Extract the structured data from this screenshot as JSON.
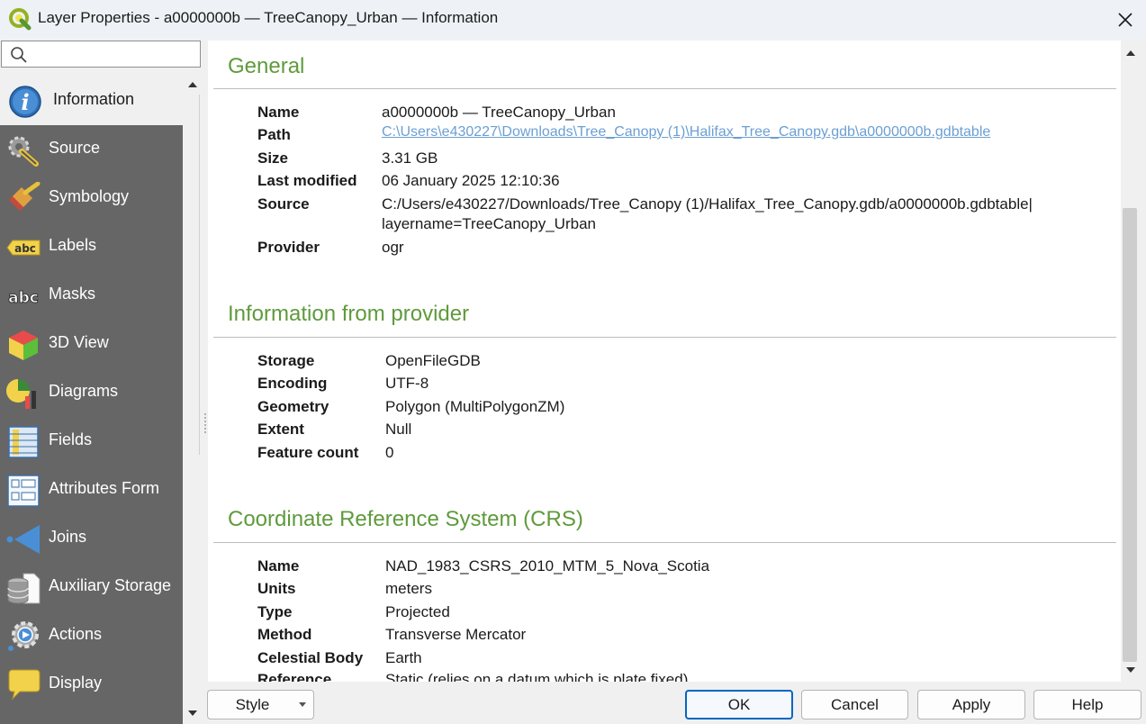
{
  "window": {
    "title": "Layer Properties - a0000000b — TreeCanopy_Urban — Information"
  },
  "search": {
    "placeholder": "",
    "value": ""
  },
  "sidebar": {
    "items": [
      {
        "label": "Information",
        "icon": "info-icon",
        "active": true
      },
      {
        "label": "Source",
        "icon": "source-wrench-icon"
      },
      {
        "label": "Symbology",
        "icon": "paintbrush-icon"
      },
      {
        "label": "Labels",
        "icon": "labels-abc-icon"
      },
      {
        "label": "Masks",
        "icon": "masks-abc-icon"
      },
      {
        "label": "3D View",
        "icon": "cube-icon"
      },
      {
        "label": "Diagrams",
        "icon": "diagram-icon"
      },
      {
        "label": "Fields",
        "icon": "fields-icon"
      },
      {
        "label": "Attributes Form",
        "icon": "form-icon"
      },
      {
        "label": "Joins",
        "icon": "joins-icon"
      },
      {
        "label": "Auxiliary Storage",
        "icon": "database-icon"
      },
      {
        "label": "Actions",
        "icon": "actions-gear-icon"
      },
      {
        "label": "Display",
        "icon": "speech-bubble-icon"
      }
    ]
  },
  "general": {
    "title": "General",
    "rows": [
      {
        "key": "Name",
        "value": "a0000000b — TreeCanopy_Urban"
      },
      {
        "key": "Path",
        "value": "C:\\Users\\e430227\\Downloads\\Tree_Canopy (1)\\Halifax_Tree_Canopy.gdb\\a0000000b.gdbtable"
      },
      {
        "key": "Size",
        "value": "3.31 GB"
      },
      {
        "key": "Last modified",
        "value": "06 January 2025 12:10:36"
      },
      {
        "key": "Source",
        "value": "C:/Users/e430227/Downloads/Tree_Canopy (1)/Halifax_Tree_Canopy.gdb/a0000000b.gdbtable|",
        "value2": "layername=TreeCanopy_Urban"
      },
      {
        "key": "Provider",
        "value": "ogr"
      }
    ]
  },
  "provider": {
    "title": "Information from provider",
    "rows": [
      {
        "key": "Storage",
        "value": "OpenFileGDB"
      },
      {
        "key": "Encoding",
        "value": "UTF-8"
      },
      {
        "key": "Geometry",
        "value": "Polygon (MultiPolygonZM)"
      },
      {
        "key": "Extent",
        "value": "Null"
      },
      {
        "key": "Feature count",
        "value": "0"
      }
    ]
  },
  "crs": {
    "title": "Coordinate Reference System (CRS)",
    "rows": [
      {
        "key": "Name",
        "value": "NAD_1983_CSRS_2010_MTM_5_Nova_Scotia"
      },
      {
        "key": "Units",
        "value": "meters"
      },
      {
        "key": "Type",
        "value": "Projected"
      },
      {
        "key": "Method",
        "value": "Transverse Mercator"
      },
      {
        "key": "Celestial Body",
        "value": "Earth"
      },
      {
        "key": "Reference",
        "value": "Static (relies on a datum which is plate fixed)"
      }
    ]
  },
  "buttons": {
    "style": "Style",
    "ok": "OK",
    "cancel": "Cancel",
    "apply": "Apply",
    "help": "Help"
  },
  "colors": {
    "section_title": "#5f9a3c",
    "sidebar_bg": "#666666",
    "link": "#6b9fd3",
    "default_button_border": "#0067c0"
  }
}
